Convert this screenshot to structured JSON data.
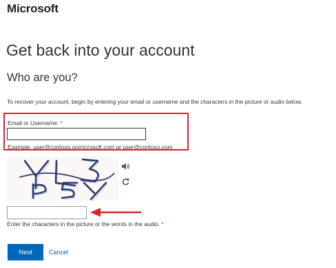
{
  "brand": "Microsoft",
  "page_title": "Get back into your account",
  "subtitle": "Who are you?",
  "instruction": "To recover your account, begin by entering your email or username and the characters in the picture or audio below.",
  "email_field": {
    "label": "Email or Username:",
    "required_marker": "*",
    "value": "",
    "example": "Example: user@contoso.onmicrosoft.com or user@contoso.com"
  },
  "captcha": {
    "icons": {
      "audio": "speaker-icon",
      "refresh": "refresh-icon"
    },
    "input_value": "",
    "hint": "Enter the characters in the picture or the words in the audio.",
    "required_marker": "*"
  },
  "actions": {
    "next_label": "Next",
    "cancel_label": "Cancel"
  },
  "colors": {
    "accent": "#0067b8",
    "annotation_red": "#d6262c",
    "text": "#333333"
  }
}
